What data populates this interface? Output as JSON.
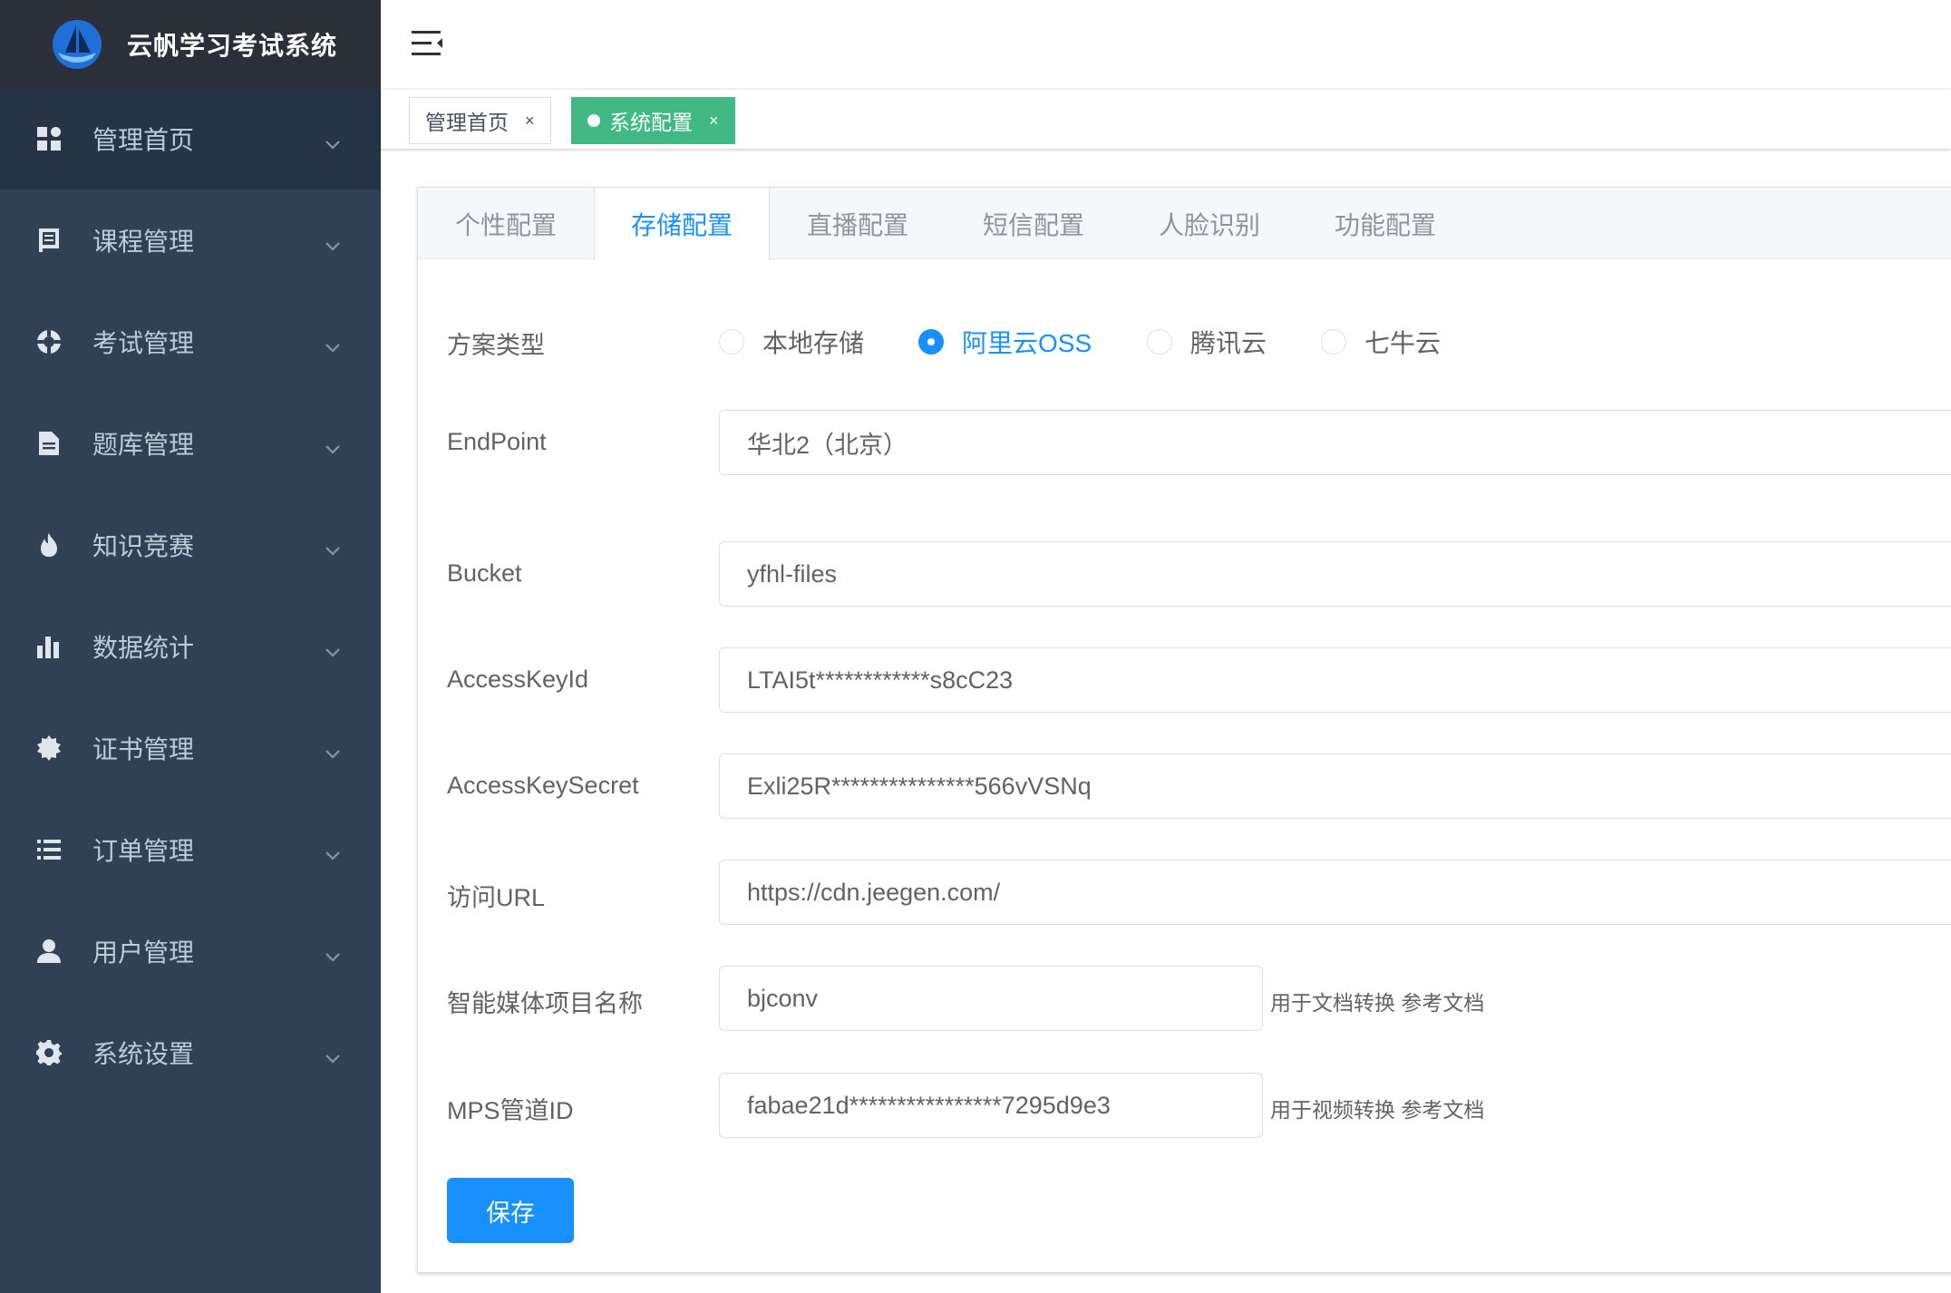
{
  "app": {
    "title": "云帆学习考试系统"
  },
  "sidebar": {
    "items": [
      {
        "label": "管理首页",
        "icon": "dashboard-icon"
      },
      {
        "label": "课程管理",
        "icon": "course-icon"
      },
      {
        "label": "考试管理",
        "icon": "exam-icon"
      },
      {
        "label": "题库管理",
        "icon": "question-bank-icon"
      },
      {
        "label": "知识竞赛",
        "icon": "fire-icon"
      },
      {
        "label": "数据统计",
        "icon": "bar-chart-icon"
      },
      {
        "label": "证书管理",
        "icon": "certificate-icon"
      },
      {
        "label": "订单管理",
        "icon": "list-icon"
      },
      {
        "label": "用户管理",
        "icon": "user-icon"
      },
      {
        "label": "系统设置",
        "icon": "gear-icon"
      }
    ]
  },
  "tags": [
    {
      "label": "管理首页",
      "close": "×"
    },
    {
      "label": "系统配置",
      "close": "×"
    }
  ],
  "tabs": [
    "个性配置",
    "存储配置",
    "直播配置",
    "短信配置",
    "人脸识别",
    "功能配置"
  ],
  "form": {
    "scheme": {
      "label": "方案类型",
      "options": [
        "本地存储",
        "阿里云OSS",
        "腾讯云",
        "七牛云"
      ],
      "selected": "阿里云OSS"
    },
    "endpoint": {
      "label": "EndPoint",
      "value": "华北2（北京）"
    },
    "bucket": {
      "label": "Bucket",
      "value": "yfhl-files"
    },
    "access_key_id": {
      "label": "AccessKeyId",
      "value": "LTAI5t************s8cC23"
    },
    "access_key_secret": {
      "label": "AccessKeySecret",
      "value": "Exli25R***************566vVSNq"
    },
    "access_url": {
      "label": "访问URL",
      "value": "https://cdn.jeegen.com/"
    },
    "media_project": {
      "label": "智能媒体项目名称",
      "value": "bjconv",
      "help": "用于文档转换 参考文档"
    },
    "mps_pipeline": {
      "label": "MPS管道ID",
      "value": "fabae21d****************7295d9e3",
      "help": "用于视频转换 参考文档"
    }
  },
  "save_label": "保存",
  "colors": {
    "sidebar_bg": "#304156",
    "primary": "#1890ff",
    "tag_active": "#42b983"
  }
}
